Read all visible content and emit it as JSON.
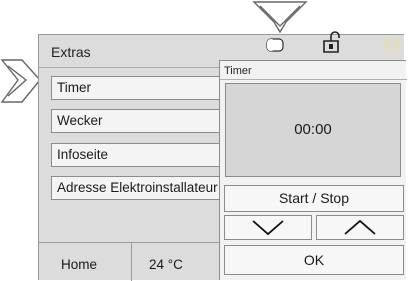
{
  "header": {
    "title": "Extras"
  },
  "menu": {
    "items": [
      {
        "label": "Timer"
      },
      {
        "label": "Wecker"
      },
      {
        "label": "Infoseite"
      },
      {
        "label": "Adresse Elektroinstallateur"
      }
    ]
  },
  "status_icons": [
    "battery-icon",
    "lock-icon",
    "signal-waves-icon"
  ],
  "bottom_bar": {
    "home_label": "Home",
    "temperature": "24 °C"
  },
  "timer_popup": {
    "title": "Timer",
    "time": "00:00",
    "start_stop_label": "Start / Stop",
    "down_icon": "chevron-down-icon",
    "up_icon": "chevron-up-icon",
    "ok_label": "OK"
  },
  "callouts": [
    "callout-arrow-down",
    "callout-arrow-right"
  ],
  "colors": {
    "screen_bg": "#dcdcdc",
    "button_bg": "#f4f4f4",
    "border": "#8c8c8c"
  }
}
